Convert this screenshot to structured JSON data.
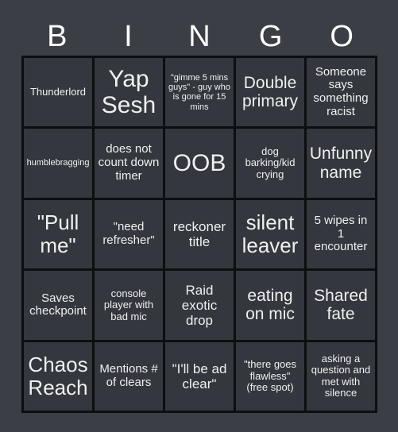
{
  "card": {
    "title": "BINGO",
    "header_letters": [
      "B",
      "I",
      "N",
      "G",
      "O"
    ],
    "colors": {
      "page_background": "#3b3e44",
      "cell_background": "#34373d",
      "grid_line": "#0d0e10",
      "text": "#f0f0f0",
      "header_text": "#ffffff"
    },
    "grid_size": "5x5",
    "free_spot_text": "\"there goes flawless\" (free spot)",
    "rows": [
      [
        {
          "text": "Thunderlord",
          "size": "s"
        },
        {
          "text": "Yap Sesh",
          "size": "3xl"
        },
        {
          "text": "\"gimme 5 mins guys\" - guy who is gone for 15 mins",
          "size": "xs"
        },
        {
          "text": "Double primary",
          "size": "xl"
        },
        {
          "text": "Someone says something racist",
          "size": "m"
        }
      ],
      [
        {
          "text": "humblebragging",
          "size": "xs"
        },
        {
          "text": "does not count down timer",
          "size": "m"
        },
        {
          "text": "OOB",
          "size": "3xl"
        },
        {
          "text": "dog barking/kid crying",
          "size": "s"
        },
        {
          "text": "Unfunny name",
          "size": "xl"
        }
      ],
      [
        {
          "text": "\"Pull me\"",
          "size": "xxl"
        },
        {
          "text": "\"need refresher\"",
          "size": "m"
        },
        {
          "text": "reckoner title",
          "size": "l"
        },
        {
          "text": "silent leaver",
          "size": "xxl"
        },
        {
          "text": "5 wipes in 1 encounter",
          "size": "m"
        }
      ],
      [
        {
          "text": "Saves checkpoint",
          "size": "m"
        },
        {
          "text": "console player with bad mic",
          "size": "s"
        },
        {
          "text": "Raid exotic drop",
          "size": "l"
        },
        {
          "text": "eating on mic",
          "size": "xl"
        },
        {
          "text": "Shared fate",
          "size": "xl"
        }
      ],
      [
        {
          "text": "Chaos Reach",
          "size": "xxl"
        },
        {
          "text": "Mentions # of clears",
          "size": "m"
        },
        {
          "text": "\"I'll be ad clear\"",
          "size": "l"
        },
        {
          "text": "\"there goes flawless\" (free spot)",
          "size": "s"
        },
        {
          "text": "asking a question and met with silence",
          "size": "s"
        }
      ]
    ]
  }
}
